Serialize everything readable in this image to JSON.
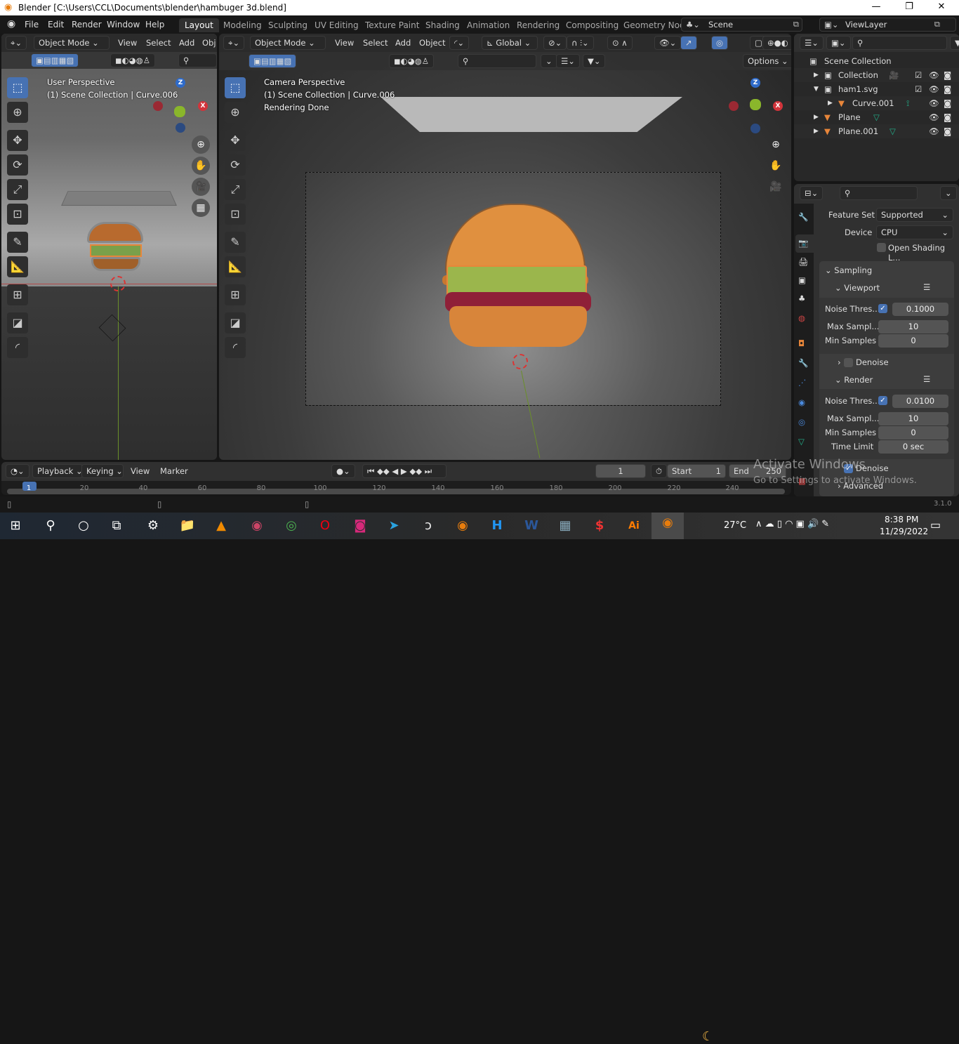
{
  "window": {
    "title": "Blender [C:\\Users\\CCL\\Documents\\blender\\hambuger 3d.blend]",
    "controls": [
      "minimize",
      "maximize",
      "close"
    ]
  },
  "menubar": {
    "items": [
      "File",
      "Edit",
      "Render",
      "Window",
      "Help"
    ]
  },
  "workspaces": {
    "tabs": [
      "Layout",
      "Modeling",
      "Sculpting",
      "UV Editing",
      "Texture Paint",
      "Shading",
      "Animation",
      "Rendering",
      "Compositing",
      "Geometry Nod"
    ],
    "active": "Layout"
  },
  "scene": {
    "name": "Scene",
    "view_layer": "ViewLayer"
  },
  "left_viewport": {
    "mode": "Object Mode",
    "menus": [
      "View",
      "Select",
      "Add",
      "Obj"
    ],
    "overlay_title": "User Perspective",
    "overlay_sub": "(1) Scene Collection | Curve.006"
  },
  "main_viewport": {
    "mode": "Object Mode",
    "menus": [
      "View",
      "Select",
      "Add",
      "Object"
    ],
    "orientation": "Global",
    "options": "Options",
    "overlay_title": "Camera Perspective",
    "overlay_sub": "(1) Scene Collection | Curve.006",
    "overlay_status": "Rendering Done"
  },
  "gizmo": {
    "z": "Z",
    "y": "Y",
    "x": "X"
  },
  "outliner": {
    "root": "Scene Collection",
    "items": [
      {
        "name": "Collection",
        "indent": 1,
        "expanded": false
      },
      {
        "name": "ham1.svg",
        "indent": 1,
        "expanded": true
      },
      {
        "name": "Curve.001",
        "indent": 2,
        "expanded": false
      },
      {
        "name": "Plane",
        "indent": 1,
        "expanded": false
      },
      {
        "name": "Plane.001",
        "indent": 1,
        "expanded": false
      }
    ]
  },
  "properties": {
    "feature_set_label": "Feature Set",
    "feature_set": "Supported",
    "device_label": "Device",
    "device": "CPU",
    "open_shading": "Open Shading L...",
    "sampling": "Sampling",
    "viewport": {
      "title": "Viewport",
      "noise_label": "Noise Thres...",
      "noise_enabled": true,
      "noise": "0.1000",
      "max_label": "Max Sampl...",
      "max": "10",
      "min_label": "Min Samples",
      "min": "0",
      "denoise": "Denoise",
      "denoise_enabled": false
    },
    "render": {
      "title": "Render",
      "noise_label": "Noise Thres...",
      "noise_enabled": true,
      "noise": "0.0100",
      "max_label": "Max Sampl...",
      "max": "10",
      "min_label": "Min Samples",
      "min": "0",
      "time_label": "Time Limit",
      "time": "0 sec",
      "denoise": "Denoise",
      "denoise_enabled": true
    },
    "advanced": "Advanced"
  },
  "timeline": {
    "menus": [
      "Playback",
      "Keying",
      "View",
      "Marker"
    ],
    "current_frame": "1",
    "start_label": "Start",
    "start": "1",
    "end_label": "End",
    "end": "250",
    "ticks": [
      "1",
      "20",
      "40",
      "60",
      "80",
      "100",
      "120",
      "140",
      "160",
      "180",
      "200",
      "220",
      "240"
    ]
  },
  "status": {
    "version": "3.1.0"
  },
  "watermark": {
    "line1": "Activate Windows",
    "line2": "Go to Settings to activate Windows."
  },
  "taskbar": {
    "apps": [
      "settings",
      "file-explorer",
      "vlc",
      "music",
      "chrome",
      "opera",
      "instagram",
      "telegram",
      "app",
      "blender",
      "h-app",
      "word",
      "calculator",
      "s-app",
      "illustrator",
      "blender-active"
    ],
    "temperature": "27°C",
    "time": "8:38 PM",
    "date": "11/29/2022"
  },
  "colors": {
    "accent": "#4772b3",
    "bg": "#303030",
    "orange": "#e8863a"
  }
}
